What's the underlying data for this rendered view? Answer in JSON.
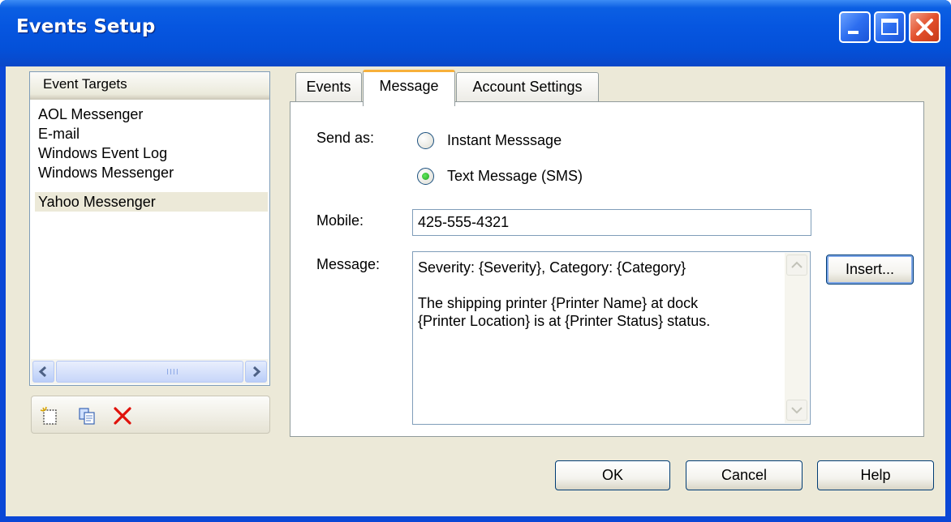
{
  "window": {
    "title": "Events Setup"
  },
  "targets": {
    "header": "Event Targets",
    "items": [
      "AOL Messenger",
      "E-mail",
      "Windows Event Log",
      "Windows Messenger",
      "Yahoo Messenger"
    ],
    "selected": "Yahoo Messenger",
    "scroll_grip": "IIII"
  },
  "tabs": [
    {
      "label": "Events"
    },
    {
      "label": "Message"
    },
    {
      "label": "Account Settings"
    }
  ],
  "active_tab": "Message",
  "message_tab": {
    "send_as_label": "Send as:",
    "options": [
      {
        "label": "Instant Messsage",
        "checked": false
      },
      {
        "label": "Text Message (SMS)",
        "checked": true
      }
    ],
    "mobile_label": "Mobile:",
    "mobile_value": "425-555-4321",
    "message_label": "Message:",
    "message_value": "Severity: {Severity}, Category: {Category}\n\nThe shipping printer {Printer Name} at dock\n{Printer Location} is at {Printer Status} status.",
    "insert_label": "Insert..."
  },
  "buttons": {
    "ok": "OK",
    "cancel": "Cancel",
    "help": "Help"
  },
  "icons": {
    "toolbar": [
      "new-icon",
      "copy-icon",
      "delete-icon"
    ],
    "delete_color": "#e0120b"
  }
}
